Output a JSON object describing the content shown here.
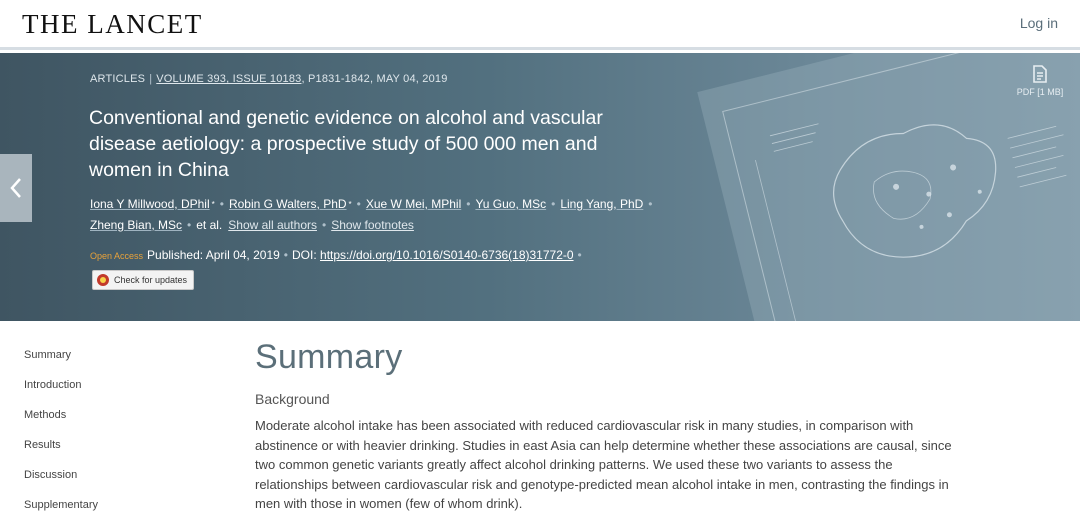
{
  "header": {
    "logo": "THE LANCET",
    "login": "Log in"
  },
  "article": {
    "type": "ARTICLES",
    "volume_issue": "VOLUME 393, ISSUE 10183",
    "pages_date": ", P1831-1842, MAY 04, 2019",
    "title": "Conventional and genetic evidence on alcohol and vascular disease aetiology: a prospective study of 500 000 men and women in China",
    "authors": [
      {
        "name": "Iona Y Millwood, DPhil",
        "sup": "*"
      },
      {
        "name": "Robin G Walters, PhD",
        "sup": "*"
      },
      {
        "name": "Xue W Mei, MPhil",
        "sup": ""
      },
      {
        "name": "Yu Guo, MSc",
        "sup": ""
      },
      {
        "name": "Ling Yang, PhD",
        "sup": ""
      },
      {
        "name": "Zheng Bian, MSc",
        "sup": ""
      }
    ],
    "et_al": "et al.",
    "show_all_authors": "Show all authors",
    "show_footnotes": "Show footnotes",
    "open_access": "Open Access",
    "published": "Published: April 04, 2019",
    "doi_label": "DOI:",
    "doi": "https://doi.org/10.1016/S0140-6736(18)31772-0",
    "check_updates": "Check for updates",
    "pdf": "PDF [1 MB]"
  },
  "sidebar": {
    "items": [
      "Summary",
      "Introduction",
      "Methods",
      "Results",
      "Discussion",
      "Supplementary"
    ]
  },
  "main": {
    "heading": "Summary",
    "section": "Background",
    "abstract": "Moderate alcohol intake has been associated with reduced cardiovascular risk in many studies, in comparison with abstinence or with heavier drinking. Studies in east Asia can help determine whether these associations are causal, since two common genetic variants greatly affect alcohol drinking patterns. We used these two variants to assess the relationships between cardiovascular risk and genotype-predicted mean alcohol intake in men, contrasting the findings in men with those in women (few of whom drink)."
  },
  "icons": {
    "prev": "chevron-left-icon",
    "pdf": "pdf-icon",
    "check": "crossmark-icon"
  },
  "colors": {
    "banner": "#4d6876",
    "summary_heading": "#5b6f79",
    "open_access": "#e8a23a"
  }
}
